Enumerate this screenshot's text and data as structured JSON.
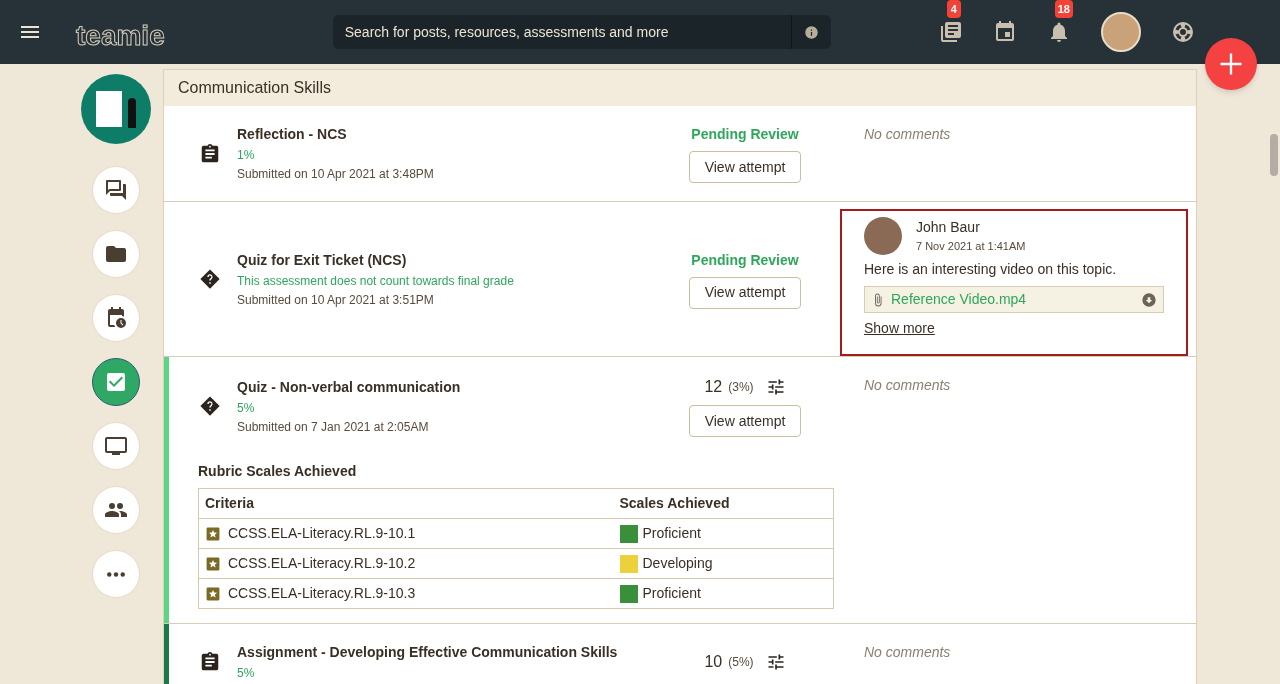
{
  "header": {
    "logo": "teamie",
    "search": {
      "placeholder": "Search for posts, resources, assessments and more"
    },
    "tools": [
      {
        "kind": "newsfeed",
        "badge": "4"
      },
      {
        "kind": "calendar"
      },
      {
        "kind": "bell",
        "badge": "18"
      },
      {
        "kind": "avatar"
      },
      {
        "kind": "help"
      }
    ]
  },
  "sidebar": {
    "items": [
      {
        "kind": "messages",
        "selected": false
      },
      {
        "kind": "folder",
        "selected": false
      },
      {
        "kind": "schedule",
        "selected": false
      },
      {
        "kind": "check",
        "selected": true
      },
      {
        "kind": "screen",
        "selected": false
      },
      {
        "kind": "people",
        "selected": false
      },
      {
        "kind": "more",
        "selected": false
      }
    ]
  },
  "section": {
    "title": "Communication Skills"
  },
  "items": [
    {
      "kind": "reflection",
      "title": "Reflection - NCS",
      "note": "1%",
      "submitted": "Submitted on 10 Apr 2021 at 3:48PM",
      "status": {
        "kind": "pending",
        "text": "Pending Review"
      },
      "button": "View attempt",
      "comments": {
        "kind": "none",
        "text": "No comments"
      }
    },
    {
      "kind": "quiz",
      "title": "Quiz for Exit Ticket (NCS)",
      "note": "This assessment does not count towards final grade",
      "submitted": "Submitted on 10 Apr 2021 at 3:51PM",
      "status": {
        "kind": "pending",
        "text": "Pending Review"
      },
      "button": "View attempt",
      "comments": {
        "kind": "comment",
        "author": "John Baur",
        "time": "7 Nov 2021 at 1:41AM",
        "text": "Here is an interesting video on this topic.",
        "attachment": "Reference Video.mp4",
        "link": "Show more"
      }
    },
    {
      "kind": "quiz",
      "color": "#5cd681",
      "title": "Quiz - Non-verbal communication",
      "note": "5%",
      "submitted": "Submitted on 7 Jan 2021 at 2:05AM",
      "status": {
        "kind": "score",
        "score": "12",
        "percent": "(3%)"
      },
      "button": "View attempt",
      "comments": {
        "kind": "none",
        "text": "No comments"
      },
      "rubric": {
        "title": "Rubric Scales Achieved",
        "columns": [
          "Criteria",
          "Scales Achieved"
        ],
        "rows": [
          {
            "criterion": "CCSS.ELA-Literacy.RL.9-10.1",
            "scale": "Proficient",
            "color": "#3a8f3a"
          },
          {
            "criterion": "CCSS.ELA-Literacy.RL.9-10.2",
            "scale": "Developing",
            "color": "#ecd03c"
          },
          {
            "criterion": "CCSS.ELA-Literacy.RL.9-10.3",
            "scale": "Proficient",
            "color": "#3a8f3a"
          }
        ]
      }
    },
    {
      "kind": "assignment",
      "color": "#1b7a45",
      "title": "Assignment - Developing Effective Communication Skills",
      "note": "5%",
      "status": {
        "kind": "score",
        "score": "10",
        "percent": "(5%)"
      },
      "comments": {
        "kind": "none",
        "text": "No comments"
      }
    }
  ]
}
